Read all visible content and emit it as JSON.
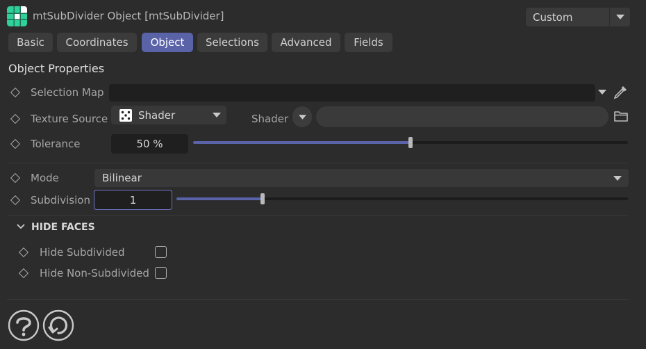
{
  "header": {
    "title": "mtSubDivider Object [mtSubDivider]",
    "preset_value": "Custom",
    "logo_color": "#3fd6a0"
  },
  "tabs": [
    {
      "label": "Basic",
      "active": false
    },
    {
      "label": "Coordinates",
      "active": false
    },
    {
      "label": "Object",
      "active": true
    },
    {
      "label": "Selections",
      "active": false
    },
    {
      "label": "Advanced",
      "active": false
    },
    {
      "label": "Fields",
      "active": false
    }
  ],
  "section_title": "Object Properties",
  "properties": {
    "selection_map": {
      "label": "Selection Map",
      "value": ""
    },
    "texture_source": {
      "label": "Texture Source",
      "value": "Shader"
    },
    "shader": {
      "label": "Shader",
      "value": ""
    },
    "tolerance": {
      "label": "Tolerance",
      "value": "50 %",
      "fraction": 0.5
    },
    "mode": {
      "label": "Mode",
      "value": "Bilinear"
    },
    "subdivision": {
      "label": "Subdivision",
      "value": "1",
      "fraction": 0.19
    }
  },
  "hide_faces": {
    "title": "HIDE FACES",
    "items": [
      {
        "label": "Hide Subdivided",
        "checked": false
      },
      {
        "label": "Hide Non-Subdivided",
        "checked": false
      }
    ]
  },
  "colors": {
    "accent": "#5a62a8",
    "background": "#2c2c2c"
  }
}
